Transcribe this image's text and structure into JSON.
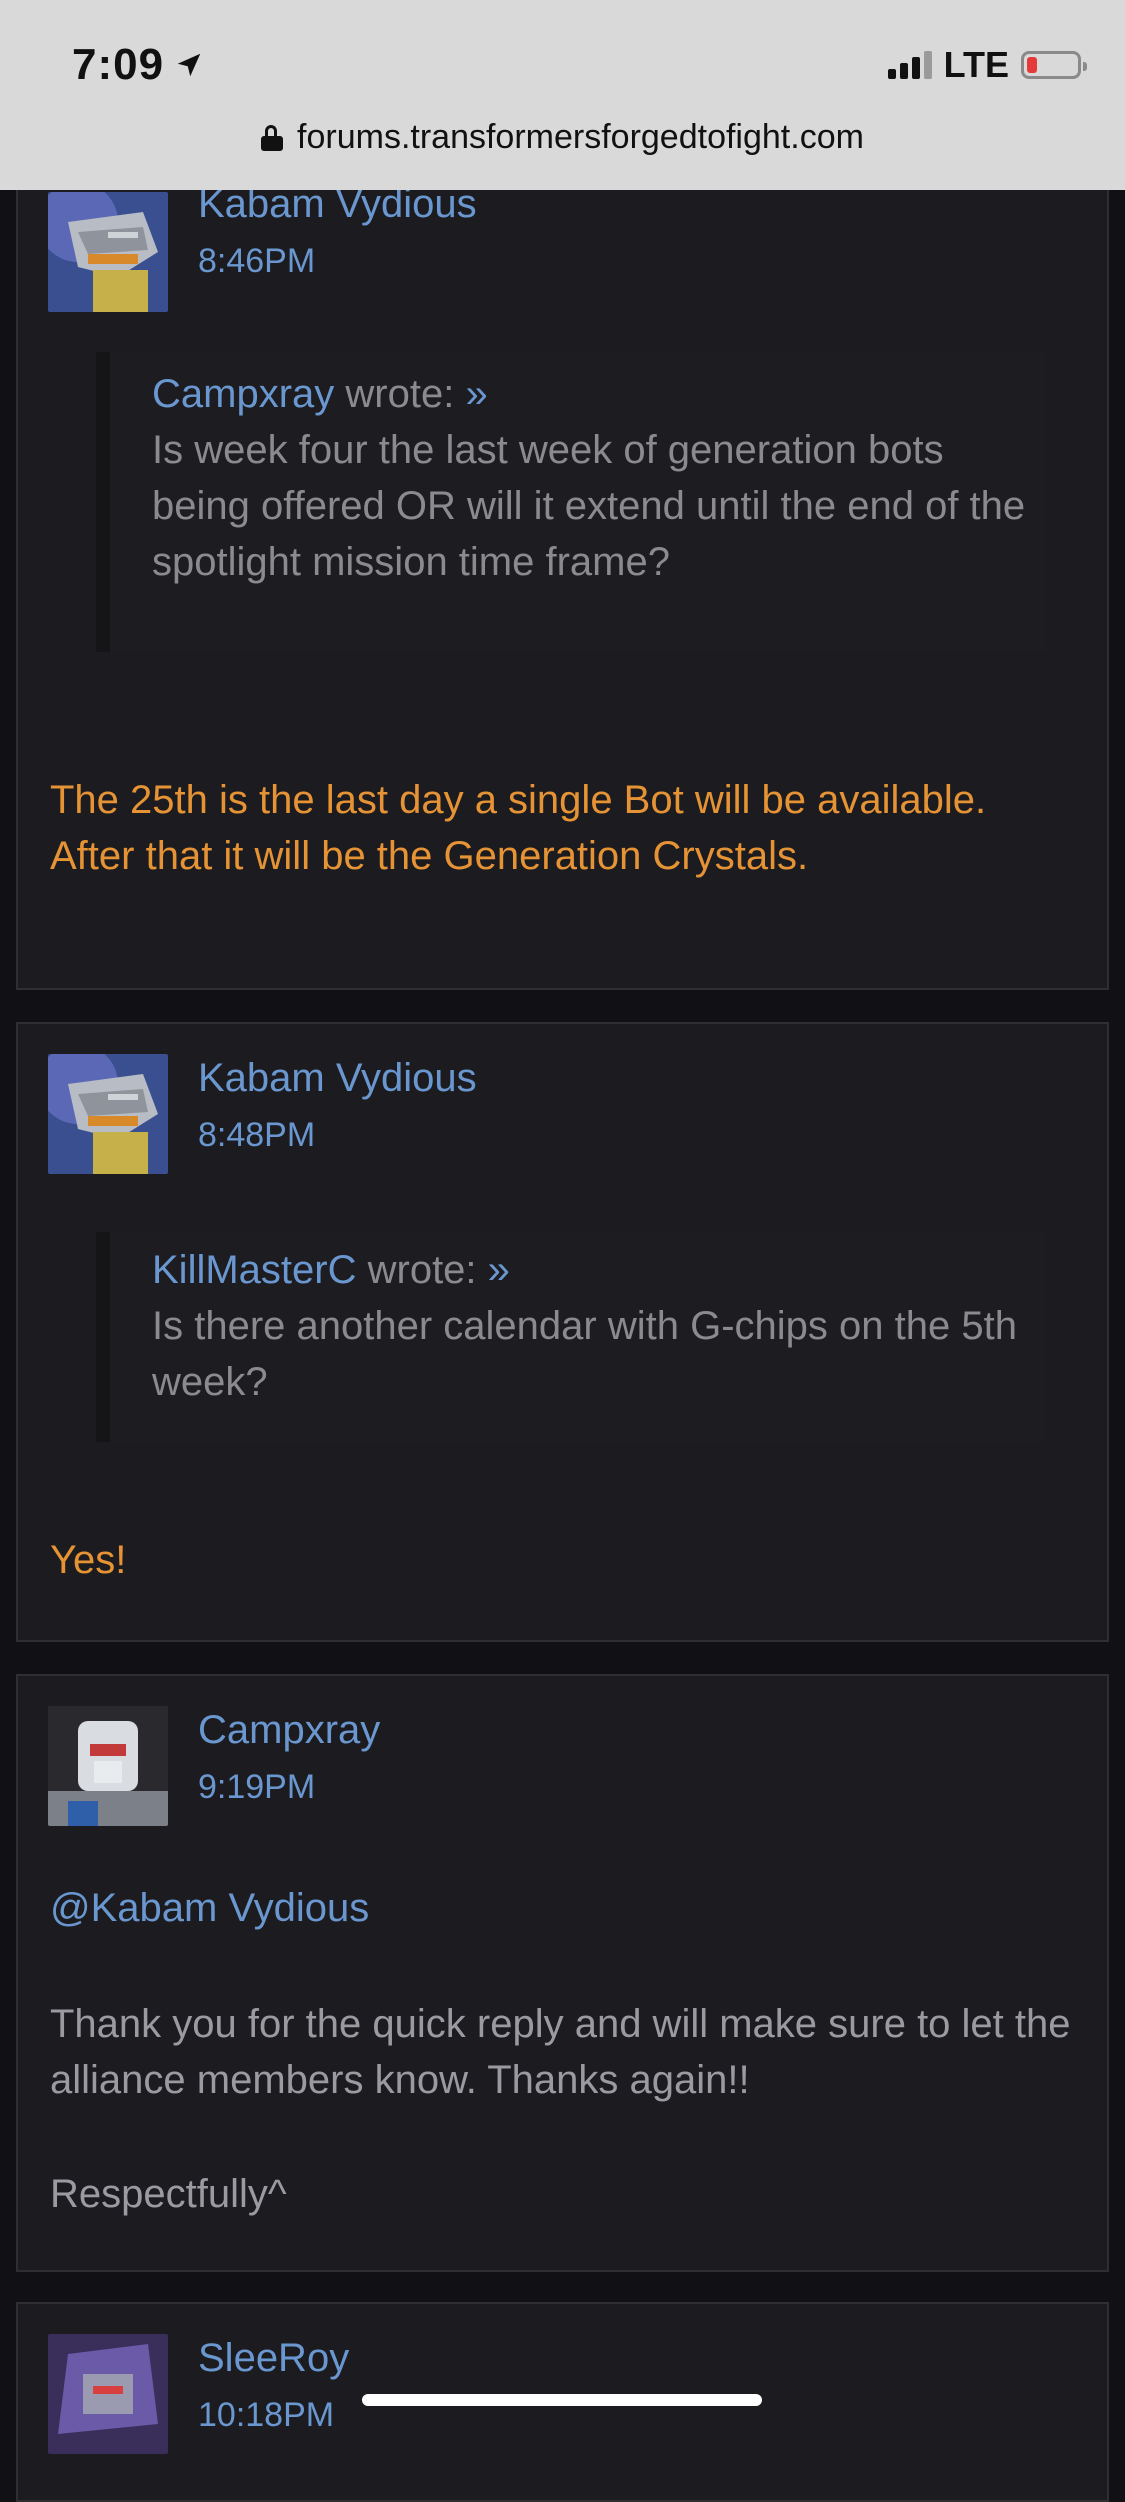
{
  "status_bar": {
    "time": "7:09",
    "network": "LTE",
    "battery_low_color": "#e43a3a"
  },
  "browser": {
    "url": "forums.transformersforgedtofight.com"
  },
  "colors": {
    "link": "#6a97cf",
    "staff_answer": "#e59334",
    "text": "#9a9aa0",
    "background": "#111115"
  },
  "posts": [
    {
      "author": "Kabam Vydious",
      "time": "8:46PM",
      "quote": {
        "author": "Campxray",
        "wrote": "wrote:",
        "arrow": "»",
        "text": "Is week four the last week of generation bots being offered OR will it extend until the end of the spotlight mission time frame?"
      },
      "reply": "The 25th is the last day a single Bot will be available. After that it will be the Generation Crystals."
    },
    {
      "author": "Kabam Vydious",
      "time": "8:48PM",
      "quote": {
        "author": "KillMasterC",
        "wrote": "wrote:",
        "arrow": "»",
        "text": "Is there another calendar with G-chips on the 5th week?"
      },
      "reply": "Yes!"
    },
    {
      "author": "Campxray",
      "time": "9:19PM",
      "mention": "@Kabam Vydious",
      "body": "Thank you for the quick reply and will make sure to let the alliance members know. Thanks again!!",
      "signoff": "Respectfully^"
    },
    {
      "author": "SleeRoy",
      "time": "10:18PM"
    }
  ]
}
